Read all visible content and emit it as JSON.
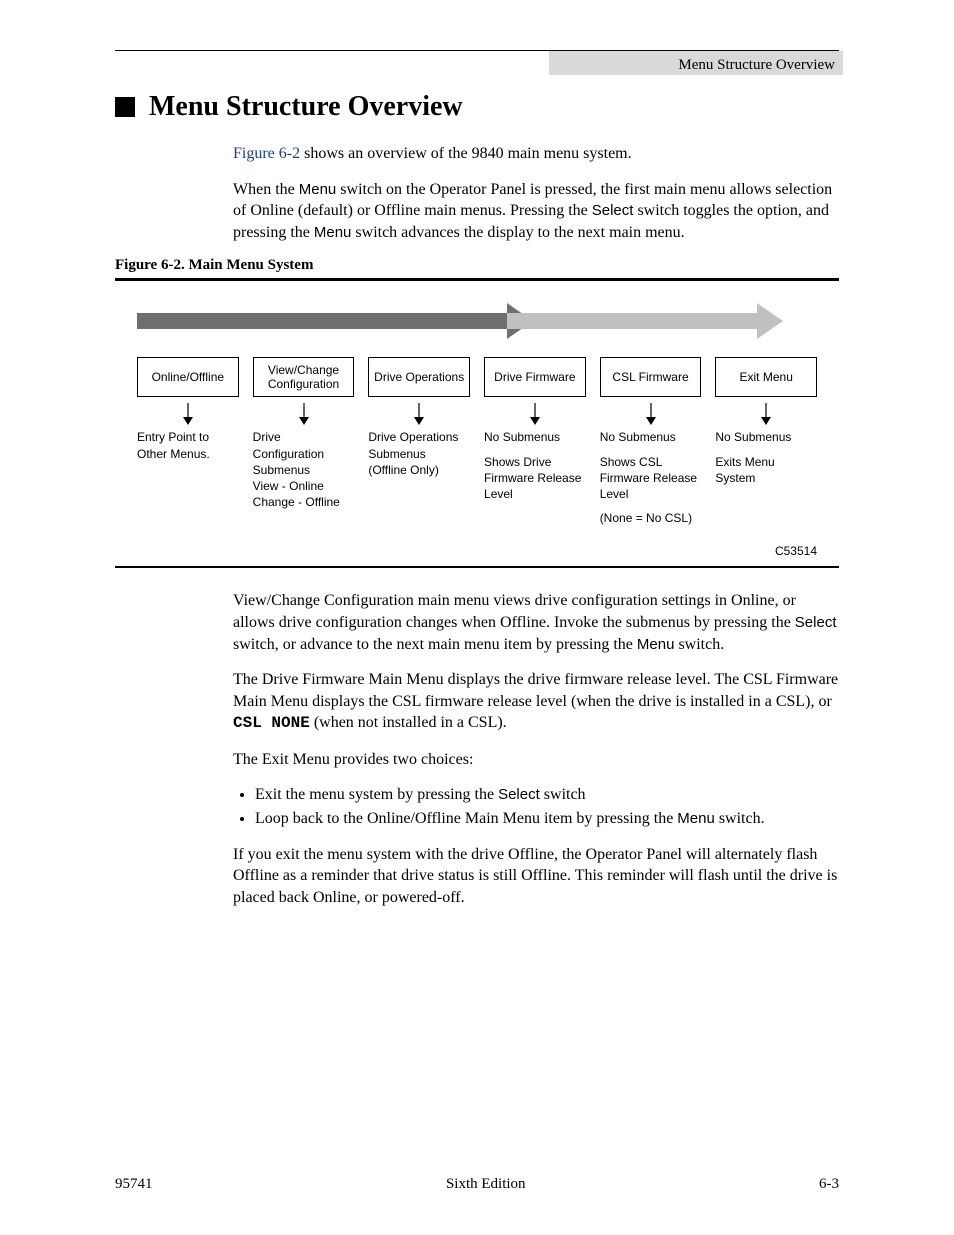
{
  "header": {
    "running_head": "Menu Structure Overview"
  },
  "title": "Menu Structure Overview",
  "intro": {
    "fig_ref": "Figure 6-2",
    "line1_rest": " shows an overview of the 9840 main menu system.",
    "p2_a": "When the ",
    "p2_menu": "Menu",
    "p2_b": " switch on the Operator Panel is pressed, the first main menu allows selection of Online (default) or Offline main menus. Pressing the ",
    "p2_select": "Select",
    "p2_c": " switch toggles the option, and pressing the ",
    "p2_menu2": "Menu",
    "p2_d": " switch advances the display to the next main menu."
  },
  "figure": {
    "caption": "Figure 6-2. Main Menu System",
    "code": "C53514",
    "cols": [
      {
        "box": "Online/Offline",
        "desc": "Entry Point to Other Menus."
      },
      {
        "box": "View/Change Configuration",
        "desc": "Drive Configuration Submenus\nView - Online\nChange - Offline"
      },
      {
        "box": "Drive Operations",
        "desc": "Drive Operations Submenus\n(Offline Only)"
      },
      {
        "box": "Drive Firmware",
        "desc": "No Submenus\n\nShows Drive Firmware Release Level"
      },
      {
        "box": "CSL Firmware",
        "desc": "No Submenus\n\nShows CSL Firmware Release Level\n\n(None = No CSL)"
      },
      {
        "box": "Exit Menu",
        "desc": "No Submenus\n\nExits Menu System"
      }
    ]
  },
  "after": {
    "p1_a": "View/Change Configuration main menu views drive configuration settings in Online, or allows drive configuration changes when Offline. Invoke the submenus by pressing the ",
    "p1_select": "Select",
    "p1_b": " switch, or advance to the next main menu item by pressing the ",
    "p1_menu": "Menu",
    "p1_c": " switch.",
    "p2_a": "The Drive Firmware Main Menu displays the drive firmware release level. The CSL Firmware Main Menu displays the CSL firmware release level (when the drive is installed in a CSL), or ",
    "p2_mono": "CSL NONE",
    "p2_b": " (when not installed in a CSL).",
    "p3": "The Exit Menu provides two choices:",
    "li1_a": "Exit the menu system by pressing the ",
    "li1_select": "Select",
    "li1_b": " switch",
    "li2_a": "Loop back to the Online/Offline Main Menu item by pressing the ",
    "li2_menu": "Menu",
    "li2_b": " switch.",
    "p4": "If you exit the menu system with the drive Offline, the Operator Panel will alternately flash Offline as a reminder that drive status is still Offline. This reminder will flash until the drive is placed back Online, or powered-off."
  },
  "footer": {
    "left": "95741",
    "center": "Sixth Edition",
    "right": "6-3"
  }
}
